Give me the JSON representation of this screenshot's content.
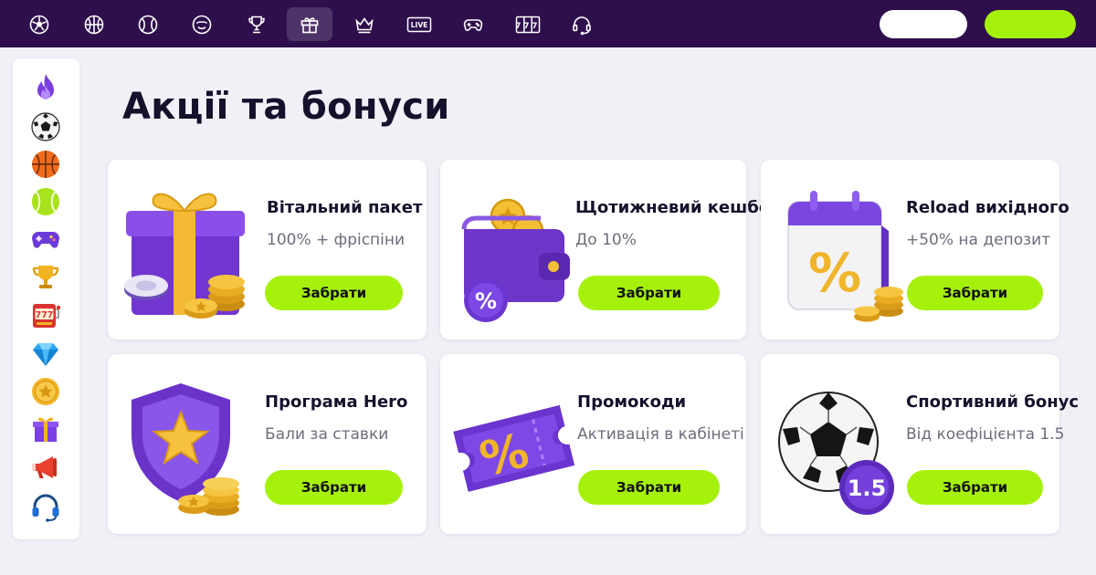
{
  "topnav": {
    "icons": [
      "football-icon",
      "basketball-icon",
      "tennis-icon",
      "smiley-icon",
      "trophy-icon",
      "gift-icon",
      "crown-icon",
      "live-icon",
      "gamepad-icon",
      "slots-777-icon",
      "headset-support-icon"
    ],
    "live_label": "LIVE",
    "slots_label": "777",
    "active_index": 5,
    "colors": {
      "bar": "#2e0f4c",
      "active": "#4e3368",
      "accent": "#a6f10c"
    }
  },
  "sidebar": {
    "icons": [
      "fire-icon",
      "football-icon",
      "basketball-icon",
      "tennis-ball-icon",
      "gamepad-icon",
      "trophy-icon",
      "slot-machine-icon",
      "diamond-icon",
      "star-coin-icon",
      "gift-icon",
      "megaphone-icon",
      "headset-icon"
    ],
    "slots_label": "777"
  },
  "page": {
    "title": "Акції та бонуси"
  },
  "promos": [
    {
      "title": "Вітальний пакет",
      "subtitle": "100% + фріспіни",
      "button": "Забрати",
      "art": "gift-box-coins-icon"
    },
    {
      "title": "Щотижневий кешбек",
      "subtitle": "До 10%",
      "button": "Забрати",
      "art": "wallet-coins-icon"
    },
    {
      "title": "Reload вихідного",
      "subtitle": "+50% на депозит",
      "button": "Забрати",
      "art": "calendar-percent-icon"
    },
    {
      "title": "Програма Hero",
      "subtitle": "Бали за ставки",
      "button": "Забрати",
      "art": "shield-star-icon"
    },
    {
      "title": "Промокоди",
      "subtitle": "Активація в кабінеті",
      "button": "Забрати",
      "art": "ticket-percent-icon"
    },
    {
      "title": "Спортивний бонус",
      "subtitle": "Від коефіцієнта 1.5",
      "button": "Забрати",
      "art": "football-odds-icon",
      "badge": "1.5"
    }
  ]
}
